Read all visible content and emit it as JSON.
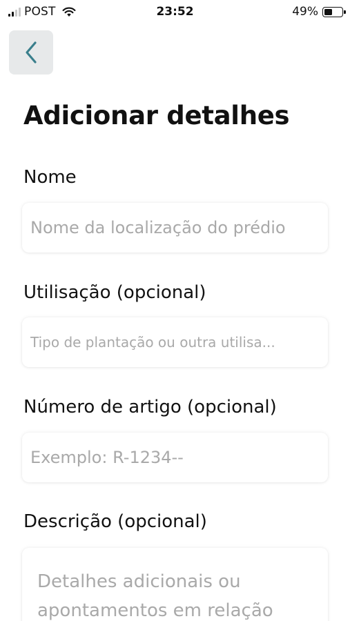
{
  "status_bar": {
    "carrier": "POST",
    "time": "23:52",
    "battery": "49%",
    "battery_level": 0.49,
    "signal_bars_active": 2,
    "signal_bars_total": 4
  },
  "header": {
    "back_icon": "chevron-left-icon",
    "title": "Adicionar detalhes"
  },
  "form": {
    "name": {
      "label": "Nome",
      "placeholder": "Nome da localização do prédio",
      "value": ""
    },
    "usage": {
      "label": "Utilisação (opcional)",
      "placeholder": "Tipo de plantação ou outra utilisa...",
      "value": ""
    },
    "article_number": {
      "label": "Número de artigo (opcional)",
      "placeholder": "Exemplo: R-1234--",
      "value": ""
    },
    "description": {
      "label": "Descrição (opcional)",
      "placeholder": "Detalhes adicionais ou apontamentos em relação",
      "value": ""
    }
  },
  "colors": {
    "accent": "#3a7f8c",
    "back_button_bg": "#e7e9ea",
    "placeholder": "#a9a9a9",
    "text": "#111111"
  }
}
